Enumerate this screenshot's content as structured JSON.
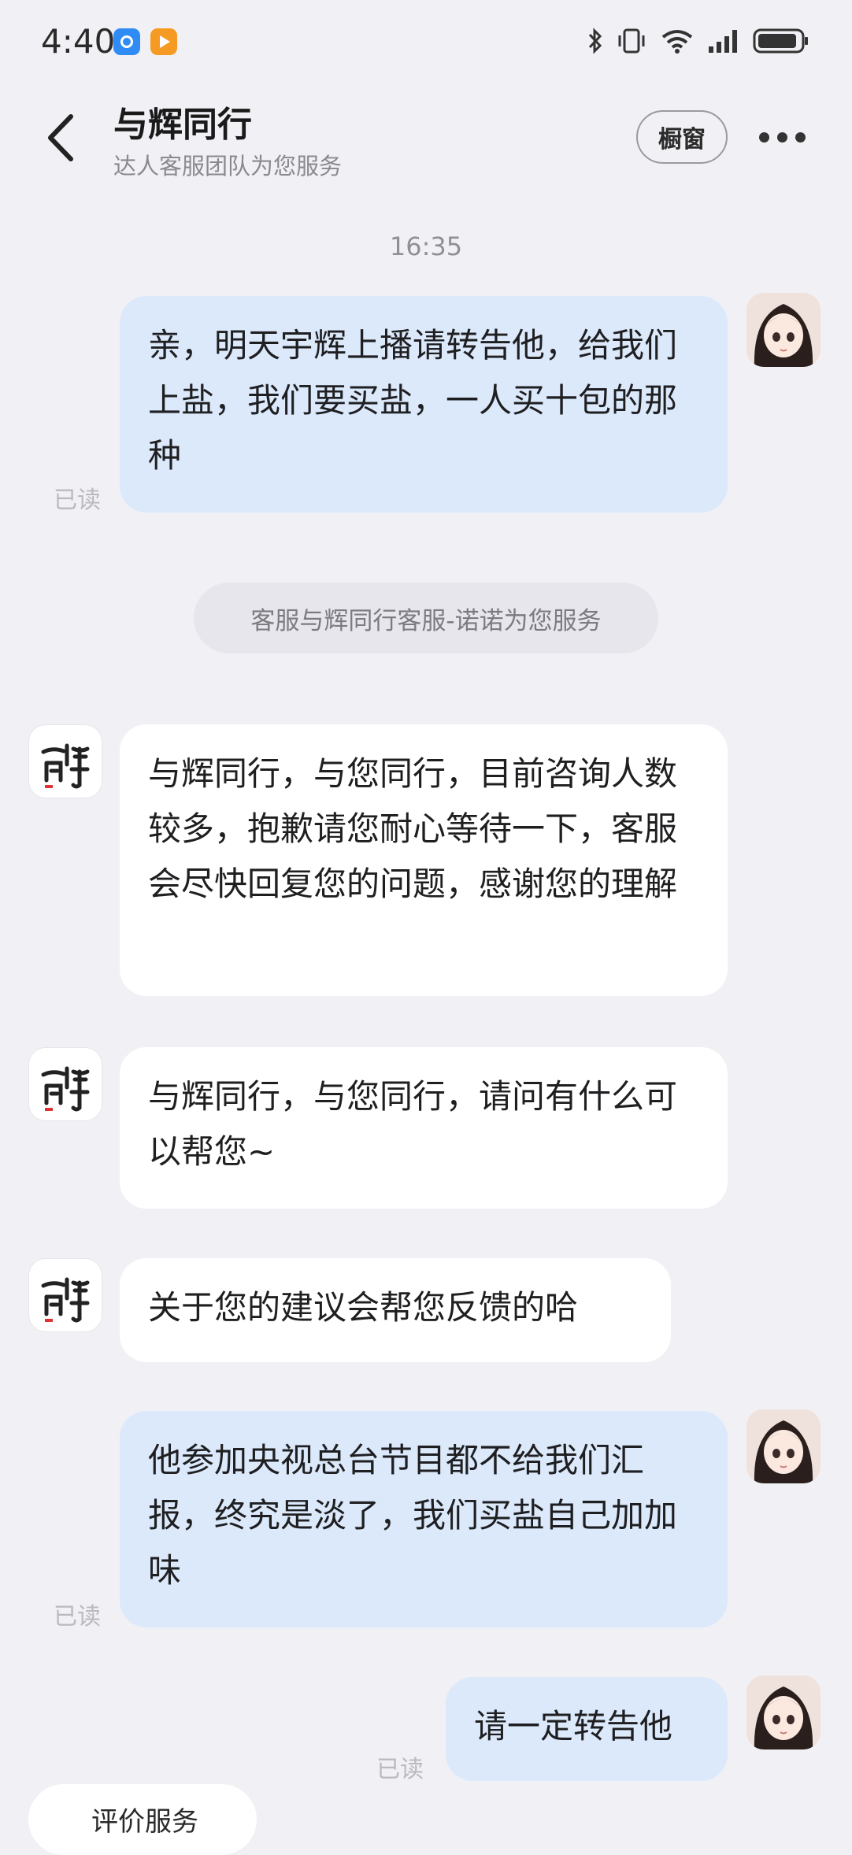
{
  "status_bar": {
    "time": "4:40",
    "app_icons": [
      "browser-icon",
      "video-app-icon"
    ],
    "indicators": [
      "bluetooth-icon",
      "vibrate-icon",
      "wifi-icon",
      "signal-icon",
      "battery-icon"
    ]
  },
  "header": {
    "title": "与辉同行",
    "subtitle": "达人客服团队为您服务",
    "shop_button": "橱窗"
  },
  "chat": {
    "timestamp": "16:35",
    "read_label": "已读",
    "system_notice": "客服与辉同行客服-诺诺为您服务",
    "messages": [
      {
        "from": "user",
        "text": "亲，明天宇辉上播请转告他，给我们上盐，我们要买盐，一人买十包的那种"
      },
      {
        "from": "agent",
        "text": "与辉同行，与您同行，目前咨询人数较多，抱歉请您耐心等待一下，客服会尽快回复您的问题，感谢您的理解"
      },
      {
        "from": "agent",
        "text": "与辉同行，与您同行，请问有什么可以帮您~"
      },
      {
        "from": "agent",
        "text": "关于您的建议会帮您反馈的哈"
      },
      {
        "from": "user",
        "text": "他参加央视总台节目都不给我们汇报，终究是淡了，我们买盐自己加加味"
      },
      {
        "from": "user",
        "text": "请一定转告他"
      }
    ]
  },
  "bottom_action": {
    "label": "评价服务"
  },
  "colors": {
    "background": "#f1f1f5",
    "user_bubble": "#dbe9fb",
    "agent_bubble": "#ffffff"
  }
}
